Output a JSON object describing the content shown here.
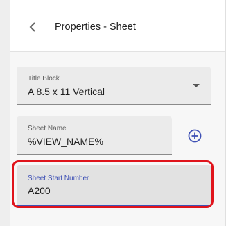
{
  "header": {
    "title": "Properties - Sheet",
    "back_icon": "chevron-left-icon"
  },
  "fields": {
    "title_block": {
      "label": "Title Block",
      "value": "A 8.5 x 11 Vertical",
      "icon": "dropdown-arrow-icon"
    },
    "sheet_name": {
      "label": "Sheet Name",
      "value": "%VIEW_NAME%"
    },
    "sheet_start_number": {
      "label": "Sheet Start Number",
      "value": "A200"
    }
  },
  "add_icon": "add-circle-icon",
  "colors": {
    "accent": "#3f51b5",
    "highlight": "#e0141c",
    "field_bg": "#ebebeb",
    "panel_bg": "#f7f7f7"
  }
}
